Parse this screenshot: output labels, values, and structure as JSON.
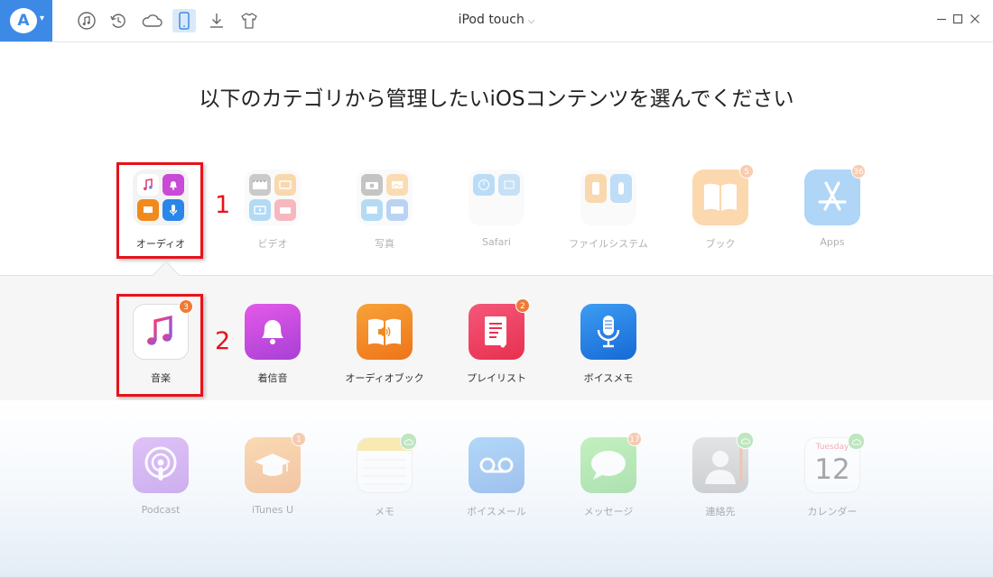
{
  "device": {
    "name": "iPod touch"
  },
  "heading": "以下のカテゴリから管理したいiOSコンテンツを選んでください",
  "toolbar": {
    "logo_letter": "A",
    "icons": [
      "music-icon",
      "restore-icon",
      "cloud-icon",
      "device-icon",
      "download-icon",
      "tshirt-icon"
    ],
    "active": "device-icon"
  },
  "categories": [
    {
      "label": "オーディオ",
      "selected": true
    },
    {
      "label": "ビデオ"
    },
    {
      "label": "写真"
    },
    {
      "label": "Safari"
    },
    {
      "label": "ファイルシステム"
    },
    {
      "label": "ブック",
      "badge": "5"
    },
    {
      "label": "Apps",
      "badge": "36"
    }
  ],
  "audio_items": [
    {
      "label": "音楽",
      "badge": "3",
      "selected": true
    },
    {
      "label": "着信音"
    },
    {
      "label": "オーディオブック"
    },
    {
      "label": "プレイリスト",
      "badge": "2"
    },
    {
      "label": "ボイスメモ"
    }
  ],
  "other_items": [
    {
      "label": "Podcast"
    },
    {
      "label": "iTunes U",
      "badge": "1"
    },
    {
      "label": "メモ",
      "cloud": true
    },
    {
      "label": "ボイスメール"
    },
    {
      "label": "メッセージ",
      "badge": "17"
    },
    {
      "label": "連絡先",
      "cloud": true
    },
    {
      "label": "カレンダー",
      "cloud": true,
      "calendar_day": "Tuesday",
      "calendar_date": "12"
    }
  ],
  "steps": [
    "1",
    "2"
  ],
  "colors": {
    "accent": "#3d8ae6",
    "highlight": "#e8111a",
    "badge": "#f07a35",
    "cloud_badge": "#5cc55c"
  }
}
